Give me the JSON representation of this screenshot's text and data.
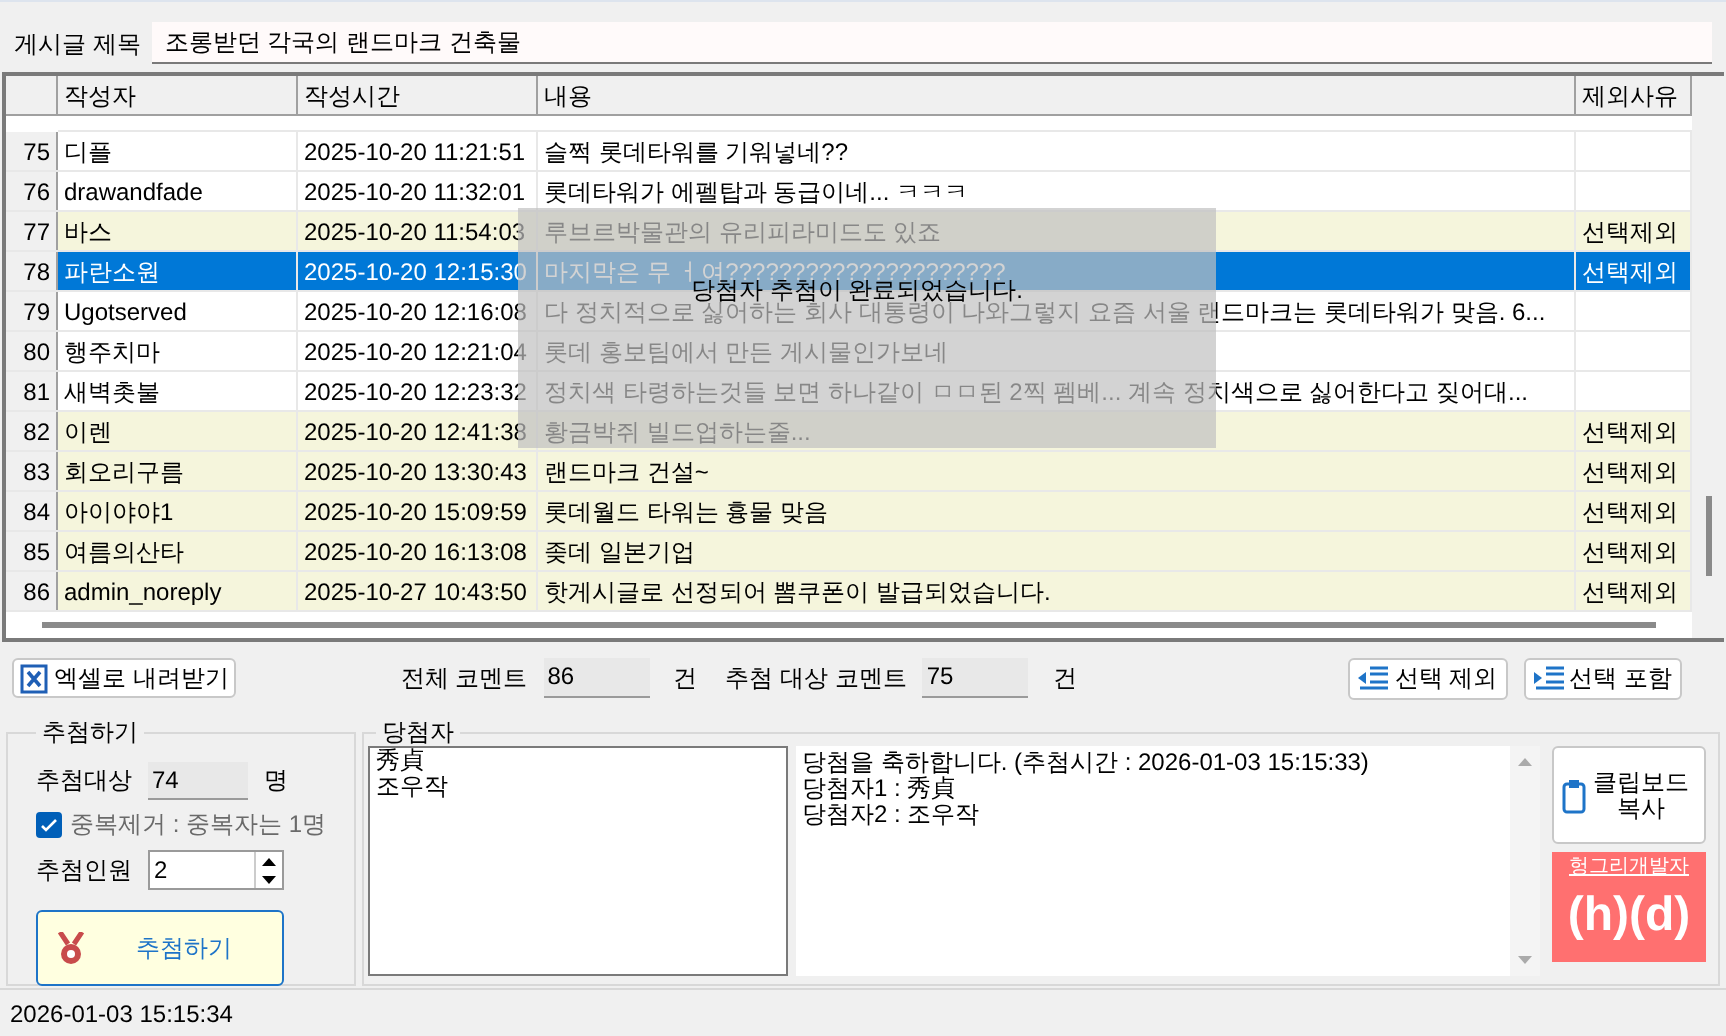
{
  "post_title": {
    "label": "게시글 제목",
    "value": "조롱받던 각국의 랜드마크 건축물"
  },
  "table": {
    "columns": [
      "작성자",
      "작성시간",
      "내용",
      "제외사유"
    ],
    "rows": [
      {
        "num": "75",
        "author": "디플",
        "time": "2025-10-20 11:21:51",
        "content": "슬쩍 롯데타워를 기워넣네??",
        "reason": "",
        "selected": false
      },
      {
        "num": "76",
        "author": "drawandfade",
        "time": "2025-10-20 11:32:01",
        "content": "롯데타워가 에펠탑과 동급이네... ㅋㅋㅋ",
        "reason": "",
        "selected": false
      },
      {
        "num": "77",
        "author": "바스",
        "time": "2025-10-20 11:54:03",
        "content": "루브르박물관의 유리피라미드도 있죠",
        "reason": "선택제외",
        "selected": false
      },
      {
        "num": "78",
        "author": "파란소원",
        "time": "2025-10-20 12:15:30",
        "content": "마지막은 무 ㅓ여?????????????????????",
        "reason": "선택제외",
        "selected": true
      },
      {
        "num": "79",
        "author": "Ugotserved",
        "time": "2025-10-20 12:16:08",
        "content": "다 정치적으로 싫어하는 회사 대통령이 나와그렇지 요즘 서울 랜드마크는 롯데타워가 맞음. 6...",
        "reason": "",
        "selected": false
      },
      {
        "num": "80",
        "author": "행주치마",
        "time": "2025-10-20 12:21:04",
        "content": "롯데 홍보팀에서 만든 게시물인가보네",
        "reason": "",
        "selected": false
      },
      {
        "num": "81",
        "author": "새벽촛불",
        "time": "2025-10-20 12:23:32",
        "content": "정치색 타령하는것들 보면 하나같이 ㅁㅁ된 2찍 펨베... 계속 정치색으로 싫어한다고 짖어대...",
        "reason": "",
        "selected": false
      },
      {
        "num": "82",
        "author": "이렌",
        "time": "2025-10-20 12:41:38",
        "content": "황금박쥐 빌드업하는줄...",
        "reason": "선택제외",
        "selected": false
      },
      {
        "num": "83",
        "author": "회오리구름",
        "time": "2025-10-20 13:30:43",
        "content": "랜드마크 건설~",
        "reason": "선택제외",
        "selected": false
      },
      {
        "num": "84",
        "author": "아이야야1",
        "time": "2025-10-20 15:09:59",
        "content": "롯데월드 타워는 흉물 맞음",
        "reason": "선택제외",
        "selected": false
      },
      {
        "num": "85",
        "author": "여름의산타",
        "time": "2025-10-20 16:13:08",
        "content": "좆데 일본기업",
        "reason": "선택제외",
        "selected": false
      },
      {
        "num": "86",
        "author": "admin_noreply",
        "time": "2025-10-27 10:43:50",
        "content": "핫게시글로 선정되어 뽐쿠폰이 발급되었습니다.",
        "reason": "선택제외",
        "selected": false
      }
    ]
  },
  "toast": "당첨자 추첨이 완료되었습니다.",
  "toolbar": {
    "export_button": "엑셀로 내려받기",
    "total_label": "전체 코멘트",
    "total_value": "86",
    "total_unit": "건",
    "target_label": "추첨 대상 코멘트",
    "target_value": "75",
    "target_unit": "건",
    "exclude_button": "선택 제외",
    "include_button": "선택 포함"
  },
  "draw": {
    "title": "추첨하기",
    "target_label": "추첨대상",
    "target_value": "74",
    "target_unit": "명",
    "dedupe": {
      "label": "중복제거 : 중복자는 1명",
      "checked": true
    },
    "count_label": "추첨인원",
    "count_value": "2",
    "draw_button": "추첨하기"
  },
  "winners": {
    "title": "당첨자",
    "list": [
      "秀貞",
      "조우작"
    ],
    "message": [
      "당첨을 축하합니다. (추첨시간 : 2026-01-03 15:15:33)",
      "당첨자1 : 秀貞",
      "당첨자2 : 조우작"
    ],
    "copy_button": "클립보드 복사"
  },
  "dev_badge": {
    "label": "헝그리개발자",
    "logo": "(h)(d)"
  },
  "status_bar": "2026-01-03 15:15:34"
}
